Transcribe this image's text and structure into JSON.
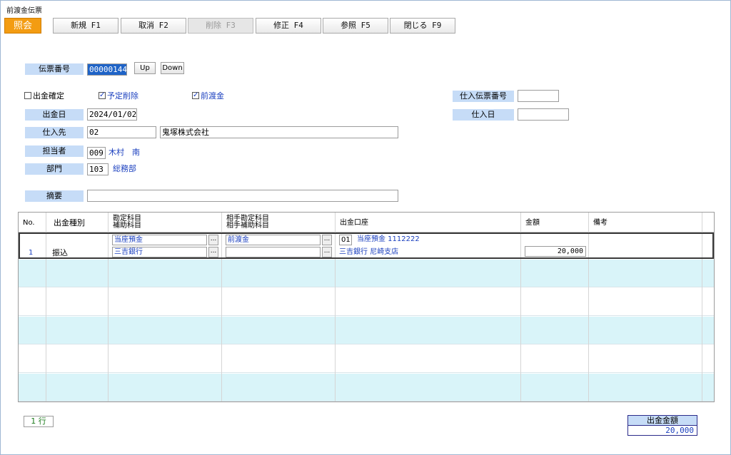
{
  "window": {
    "title": "前渡金伝票"
  },
  "toolbar": {
    "mode": "照会",
    "buttons": [
      {
        "label": "新規 F1",
        "disabled": false
      },
      {
        "label": "取消 F2",
        "disabled": false
      },
      {
        "label": "削除 F3",
        "disabled": true
      },
      {
        "label": "修正 F4",
        "disabled": false
      },
      {
        "label": "参照 F5",
        "disabled": false
      },
      {
        "label": "閉じる F9",
        "disabled": false
      }
    ]
  },
  "header": {
    "slip_no_label": "伝票番号",
    "slip_no": "00000144",
    "up_label": "Up",
    "down_label": "Down",
    "payment_confirmed_label": "出金確定",
    "planned_delete_label": "予定削除",
    "advance_label": "前渡金",
    "purchase_slip_label": "仕入伝票番号",
    "purchase_slip_value": "",
    "payment_date_label": "出金日",
    "payment_date": "2024/01/02",
    "purchase_date_label": "仕入日",
    "purchase_date_value": "",
    "supplier_label": "仕入先",
    "supplier_code": "02",
    "supplier_name": "鬼塚株式会社",
    "staff_label": "担当者",
    "staff_code": "009",
    "staff_name": "木村　南",
    "dept_label": "部門",
    "dept_code": "103",
    "dept_name": "総務部",
    "memo_label": "摘要",
    "memo_value": ""
  },
  "grid": {
    "headers": {
      "no": "No.",
      "type": "出金種別",
      "account1": "勘定科目",
      "account2": "補助科目",
      "counter1": "相手勘定科目",
      "counter2": "相手補助科目",
      "bank": "出金口座",
      "amount": "金額",
      "note": "備考"
    },
    "rows": [
      {
        "no": "1",
        "type": "振込",
        "account": "当座預金",
        "sub_account": "三吉銀行",
        "counter_account": "前渡金",
        "counter_sub_account": "",
        "bank_code": "01",
        "bank_line1": "当座預金 1112222",
        "bank_line2": "三吉銀行 尼崎支店",
        "amount": "20,000",
        "note": ""
      }
    ],
    "dots_label": "..."
  },
  "footer": {
    "row_count": "1 行",
    "total_label": "出金金額",
    "total_value": "20,000"
  }
}
